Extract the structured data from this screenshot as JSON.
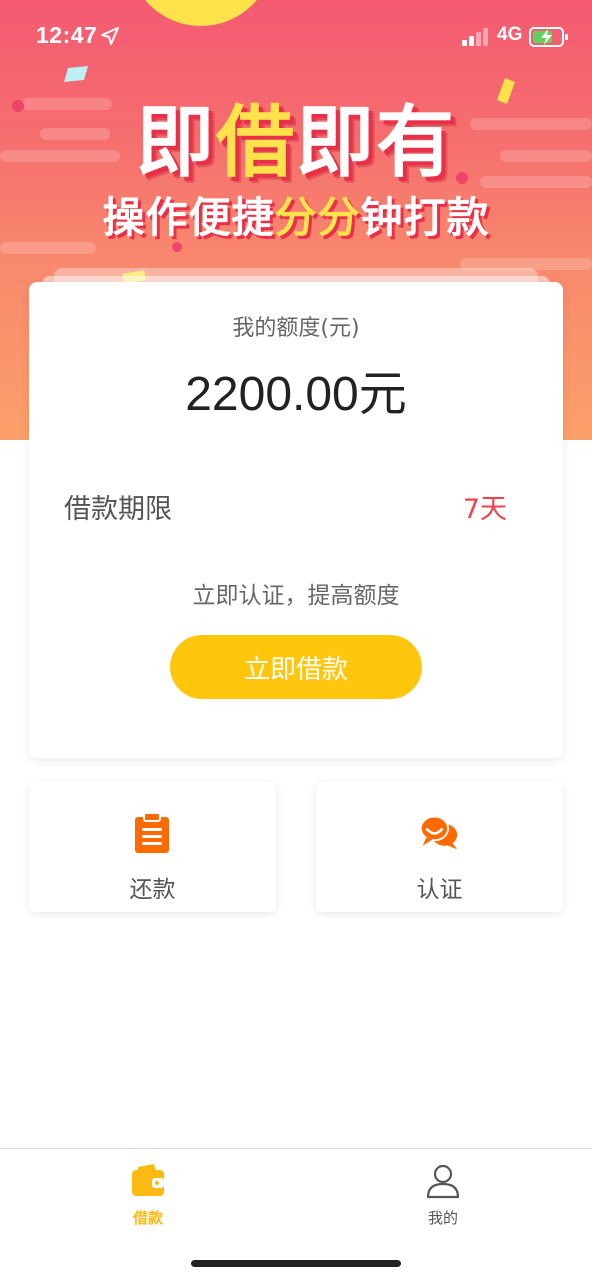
{
  "status_bar": {
    "time": "12:47",
    "network": "4G"
  },
  "banner": {
    "headline_parts": [
      "即",
      "借",
      "即",
      "有"
    ],
    "subline_parts": [
      "操作便捷",
      "分分",
      "钟打款"
    ]
  },
  "quota_card": {
    "label": "我的额度(元)",
    "amount": "2200.00元",
    "term_label": "借款期限",
    "term_value": "7天",
    "verify_tip": "立即认证，提高额度",
    "borrow_button": "立即借款"
  },
  "tiles": {
    "repay_label": "还款",
    "verify_label": "认证"
  },
  "tab_bar": {
    "loan_label": "借款",
    "mine_label": "我的",
    "active_tab": "借款"
  },
  "colors": {
    "accent_yellow": "#fec70e",
    "tab_active": "#fdb913",
    "term_red": "#f0434d",
    "tile_icon_orange": "#ff6a00",
    "banner_top": "#f45a72",
    "banner_bottom": "#fba06a"
  },
  "icons": {
    "location": "location-arrow-icon",
    "signal": "signal-bars-icon",
    "battery": "battery-charging-icon",
    "repay": "clipboard-icon",
    "verify": "chat-bubbles-icon",
    "loan_tab": "wallet-icon",
    "mine_tab": "user-icon"
  }
}
